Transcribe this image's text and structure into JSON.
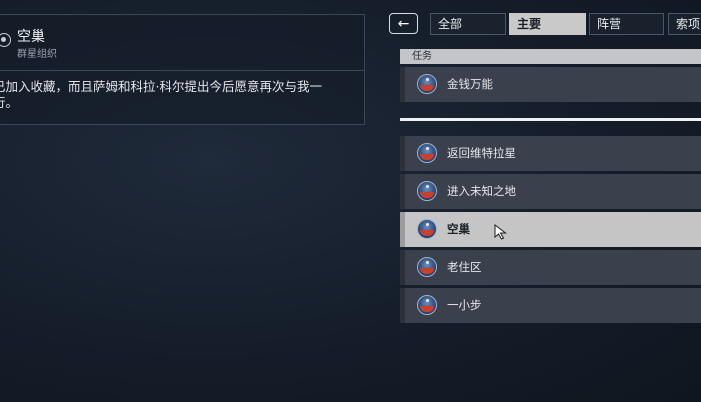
{
  "detail": {
    "title": "空巢",
    "subtitle": "群星组织",
    "body": "已加入收藏，而且萨姆和科拉·科尔提出今后愿意再次与我一\n行。"
  },
  "nav": {
    "back_symbol": "←",
    "tabs": [
      {
        "label": "全部",
        "active": false
      },
      {
        "label": "主要",
        "active": true
      },
      {
        "label": "阵营",
        "active": false
      },
      {
        "label": "索项",
        "active": false
      }
    ]
  },
  "list": {
    "header": "任务",
    "pinned": [
      {
        "label": "金钱万能",
        "icon": "mission-emblem-icon"
      }
    ],
    "items": [
      {
        "label": "返回维特拉星",
        "icon": "mission-emblem-icon",
        "selected": false
      },
      {
        "label": "进入未知之地",
        "icon": "mission-emblem-icon",
        "selected": false
      },
      {
        "label": "空巢",
        "icon": "mission-emblem-icon",
        "selected": true
      },
      {
        "label": "老住区",
        "icon": "mission-emblem-icon",
        "selected": false
      },
      {
        "label": "一小步",
        "icon": "mission-emblem-icon",
        "selected": false
      }
    ]
  },
  "colors": {
    "background": "#151d2a",
    "row": "#3b414c",
    "row_selected": "#c5c5c5",
    "emblem_red": "#c8402f",
    "emblem_blue": "#2e4c7c"
  }
}
